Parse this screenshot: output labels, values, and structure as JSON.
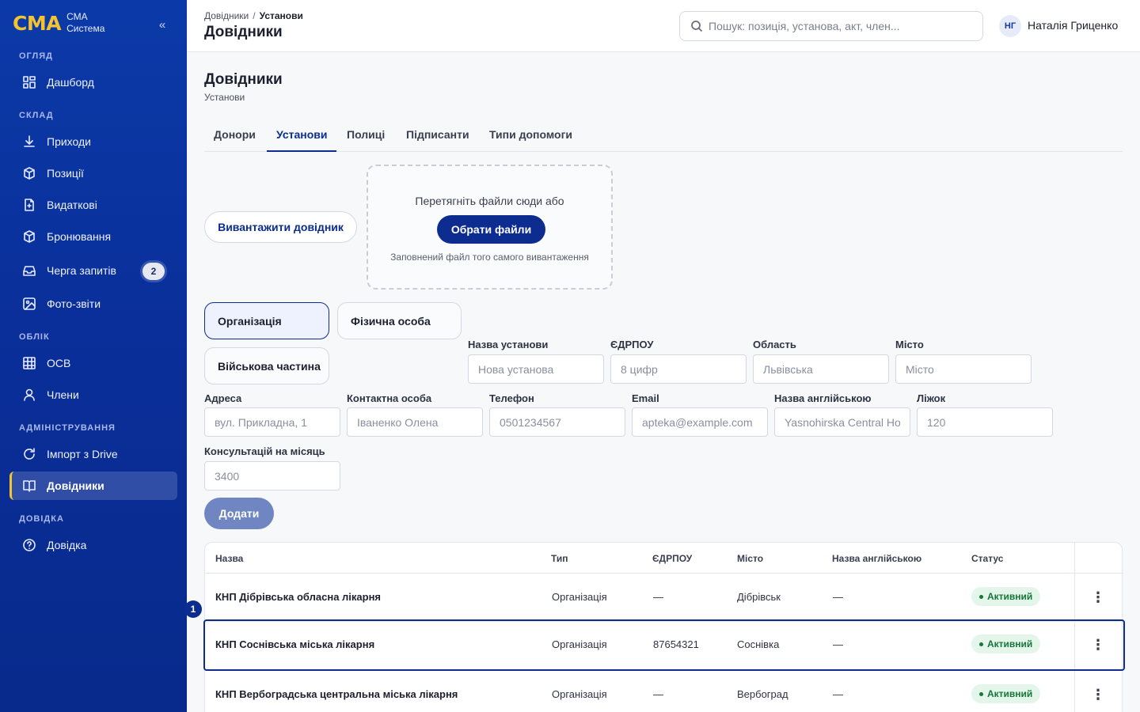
{
  "sidebar": {
    "brand_logo": "СМА",
    "brand_line1": "СМА",
    "brand_line2": "Система",
    "collapse_icon": "«",
    "sections": {
      "overview": "ОГЛЯД",
      "warehouse": "СКЛАД",
      "accounting": "ОБЛІК",
      "admin": "АДМІНІСТРУВАННЯ",
      "help": "ДОВІДКА"
    },
    "items": [
      {
        "label": "Дашборд",
        "icon": "grid-icon"
      },
      {
        "label": "Приходи",
        "icon": "download-icon"
      },
      {
        "label": "Позиції",
        "icon": "box-icon"
      },
      {
        "label": "Видаткові",
        "icon": "file-icon"
      },
      {
        "label": "Бронювання",
        "icon": "box-icon"
      },
      {
        "label": "Черга запитів",
        "icon": "inbox-icon",
        "badge": "2"
      },
      {
        "label": "Фото-звіти",
        "icon": "image-icon"
      },
      {
        "label": "ОСВ",
        "icon": "table-icon"
      },
      {
        "label": "Члени",
        "icon": "user-icon"
      },
      {
        "label": "Імпорт з Drive",
        "icon": "refresh-icon"
      },
      {
        "label": "Довідники",
        "icon": "book-icon"
      },
      {
        "label": "Довідка",
        "icon": "help-icon"
      }
    ]
  },
  "topbar": {
    "breadcrumb_root": "Довідники",
    "breadcrumb_sep": "/",
    "breadcrumb_current": "Установи",
    "title": "Довідники",
    "search_placeholder": "Пошук: позиція, установа, акт, член...",
    "avatar_initials": "НГ",
    "user_name": "Наталія Гриценко"
  },
  "page": {
    "title": "Довідники",
    "subtitle": "Установи"
  },
  "tabs": [
    "Донори",
    "Установи",
    "Полиці",
    "Підписанти",
    "Типи допомоги"
  ],
  "upload": {
    "button": "Вивантажити довідник",
    "drop_text": "Перетягніть файли сюди або",
    "choose_button": "Обрати файли",
    "note": "Заповнений файл того самого вивантаження"
  },
  "types": [
    "Організація",
    "Фізична особа",
    "Військова частина"
  ],
  "form": {
    "name": {
      "label": "Назва установи",
      "placeholder": "Нова установа"
    },
    "edrpou": {
      "label": "ЄДРПОУ",
      "placeholder": "8 цифр"
    },
    "region": {
      "label": "Область",
      "placeholder": "Львівська"
    },
    "city": {
      "label": "Місто",
      "placeholder": "Місто"
    },
    "address": {
      "label": "Адреса",
      "placeholder": "вул. Прикладна, 1"
    },
    "contact": {
      "label": "Контактна особа",
      "placeholder": "Іваненко Олена"
    },
    "phone": {
      "label": "Телефон",
      "placeholder": "0501234567"
    },
    "email": {
      "label": "Email",
      "placeholder": "apteka@example.com"
    },
    "name_en": {
      "label": "Назва англійською",
      "placeholder": "Yasnohirska Central Hospital"
    },
    "beds": {
      "label": "Ліжок",
      "placeholder": "120"
    },
    "consults": {
      "label": "Консультацій на місяць",
      "placeholder": "3400"
    },
    "add_button": "Додати"
  },
  "table": {
    "headers": [
      "Назва",
      "Тип",
      "ЄДРПОУ",
      "Місто",
      "Назва англійською",
      "Статус"
    ],
    "rows": [
      [
        "КНП Дібрівська обласна лікарня",
        "Організація",
        "—",
        "Дібрівськ",
        "—",
        "Активний"
      ],
      [
        "КНП Соснівська міська лікарня",
        "Організація",
        "87654321",
        "Соснівка",
        "—",
        "Активний"
      ],
      [
        "КНП Вербоградська центральна міська лікарня",
        "Організація",
        "—",
        "Вербоград",
        "—",
        "Активний"
      ]
    ],
    "kebab": "⋮",
    "selected_marker": "1"
  },
  "colors": {
    "sidebar_bg": "#0a2f9a",
    "accent": "#0c2d8f",
    "brand_yellow": "#f4c430",
    "status_green": "#16773b"
  }
}
